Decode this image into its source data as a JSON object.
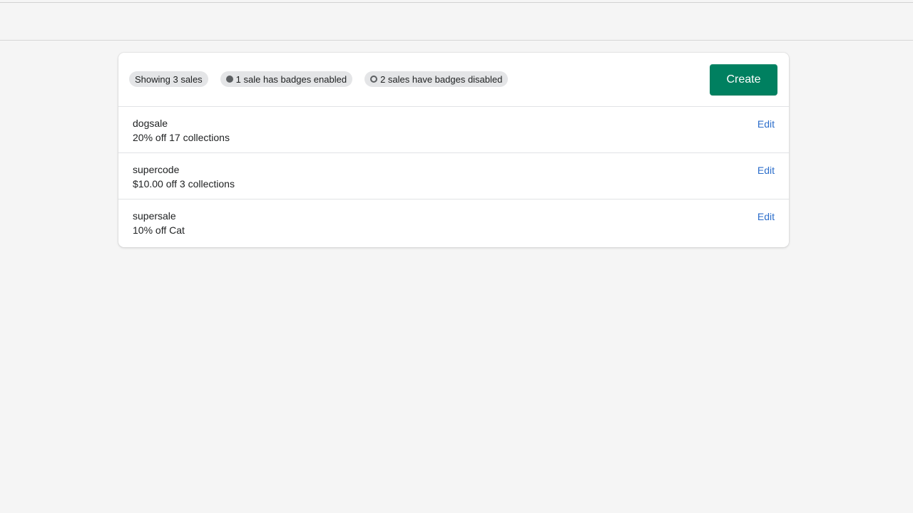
{
  "summary": {
    "showing": "Showing 3 sales",
    "enabled": "1 sale has badges enabled",
    "disabled": "2 sales have badges disabled"
  },
  "actions": {
    "create_label": "Create"
  },
  "sales": [
    {
      "name": "dogsale",
      "description": "20% off 17 collections",
      "edit_label": "Edit"
    },
    {
      "name": "supercode",
      "description": "$10.00 off 3 collections",
      "edit_label": "Edit"
    },
    {
      "name": "supersale",
      "description": "10% off Cat",
      "edit_label": "Edit"
    }
  ],
  "colors": {
    "primary": "#008060",
    "link": "#2c6ecb",
    "background": "#f5f5f5"
  }
}
